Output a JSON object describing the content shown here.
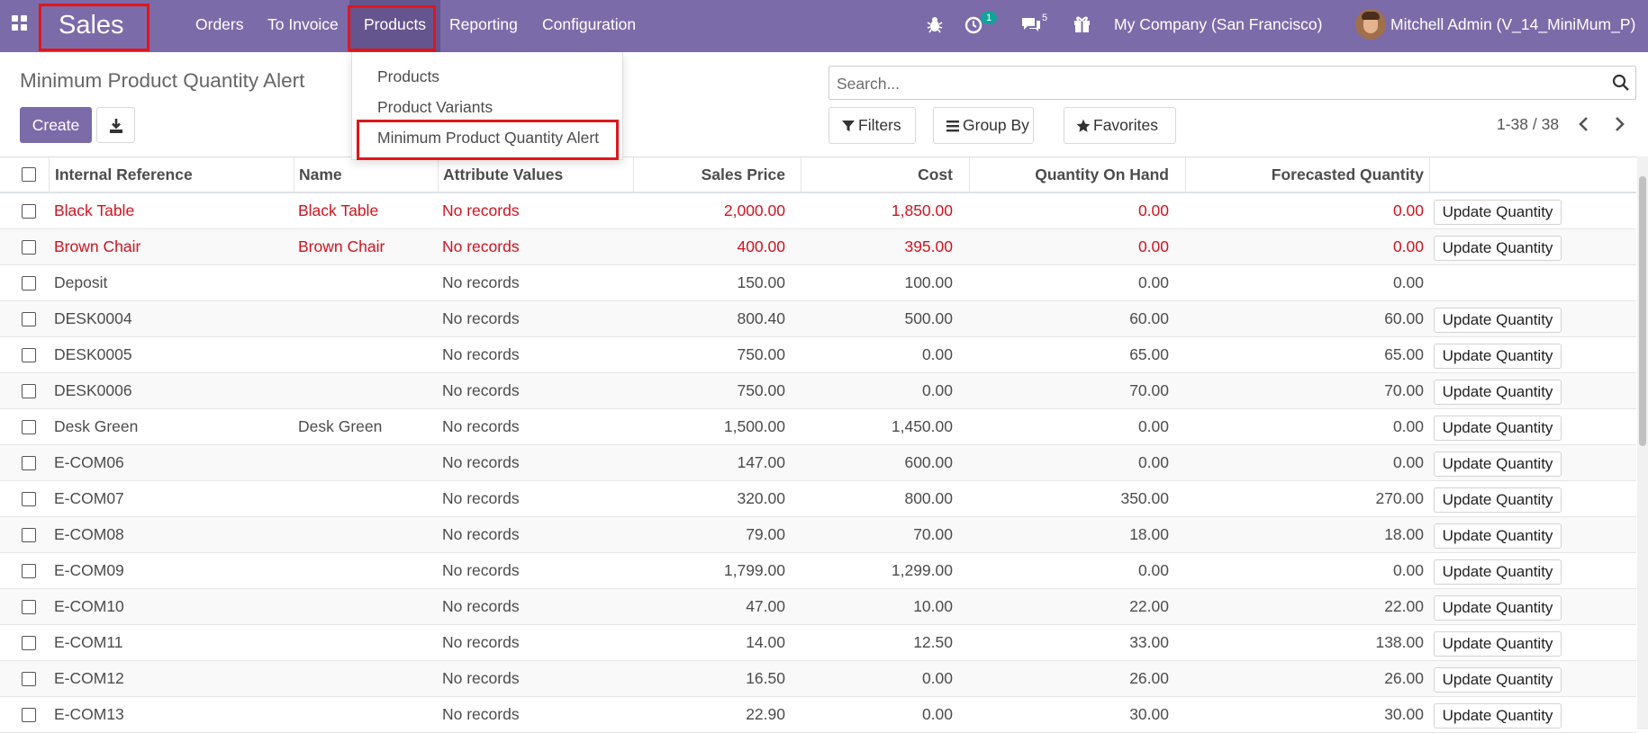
{
  "navbar": {
    "app_name": "Sales",
    "menu": [
      "Orders",
      "To Invoice",
      "Products",
      "Reporting",
      "Configuration"
    ],
    "activity_count": "1",
    "message_count": "5",
    "company": "My Company (San Francisco)",
    "user": "Mitchell Admin (V_14_MiniMum_P)",
    "icons": [
      "apps-icon",
      "bug-icon",
      "clock-icon",
      "chat-icon",
      "gift-icon"
    ]
  },
  "dropdown": {
    "items": [
      "Products",
      "Product Variants",
      "Minimum Product Quantity Alert"
    ]
  },
  "control_panel": {
    "title": "Minimum Product Quantity Alert",
    "create_label": "Create",
    "search_placeholder": "Search...",
    "filters_label": "Filters",
    "group_by_label": "Group By",
    "favorites_label": "Favorites",
    "pager": "1-38 / 38"
  },
  "table": {
    "headers": [
      "Internal Reference",
      "Name",
      "Attribute Values",
      "Sales Price",
      "Cost",
      "Quantity On Hand",
      "Forecasted Quantity"
    ],
    "update_label": "Update Quantity",
    "rows": [
      {
        "ref": "Black Table",
        "name": "Black Table",
        "attr": "No records",
        "price": "2,000.00",
        "cost": "1,850.00",
        "onhand": "0.00",
        "forecast": "0.00",
        "alert": true,
        "update": true
      },
      {
        "ref": "Brown Chair",
        "name": "Brown Chair",
        "attr": "No records",
        "price": "400.00",
        "cost": "395.00",
        "onhand": "0.00",
        "forecast": "0.00",
        "alert": true,
        "update": true
      },
      {
        "ref": "Deposit",
        "name": "",
        "attr": "No records",
        "price": "150.00",
        "cost": "100.00",
        "onhand": "0.00",
        "forecast": "0.00",
        "alert": false,
        "update": false
      },
      {
        "ref": "DESK0004",
        "name": "",
        "attr": "No records",
        "price": "800.40",
        "cost": "500.00",
        "onhand": "60.00",
        "forecast": "60.00",
        "alert": false,
        "update": true
      },
      {
        "ref": "DESK0005",
        "name": "",
        "attr": "No records",
        "price": "750.00",
        "cost": "0.00",
        "onhand": "65.00",
        "forecast": "65.00",
        "alert": false,
        "update": true
      },
      {
        "ref": "DESK0006",
        "name": "",
        "attr": "No records",
        "price": "750.00",
        "cost": "0.00",
        "onhand": "70.00",
        "forecast": "70.00",
        "alert": false,
        "update": true
      },
      {
        "ref": "Desk Green",
        "name": "Desk Green",
        "attr": "No records",
        "price": "1,500.00",
        "cost": "1,450.00",
        "onhand": "0.00",
        "forecast": "0.00",
        "alert": false,
        "update": true
      },
      {
        "ref": "E-COM06",
        "name": "",
        "attr": "No records",
        "price": "147.00",
        "cost": "600.00",
        "onhand": "0.00",
        "forecast": "0.00",
        "alert": false,
        "update": true
      },
      {
        "ref": "E-COM07",
        "name": "",
        "attr": "No records",
        "price": "320.00",
        "cost": "800.00",
        "onhand": "350.00",
        "forecast": "270.00",
        "alert": false,
        "update": true
      },
      {
        "ref": "E-COM08",
        "name": "",
        "attr": "No records",
        "price": "79.00",
        "cost": "70.00",
        "onhand": "18.00",
        "forecast": "18.00",
        "alert": false,
        "update": true
      },
      {
        "ref": "E-COM09",
        "name": "",
        "attr": "No records",
        "price": "1,799.00",
        "cost": "1,299.00",
        "onhand": "0.00",
        "forecast": "0.00",
        "alert": false,
        "update": true
      },
      {
        "ref": "E-COM10",
        "name": "",
        "attr": "No records",
        "price": "47.00",
        "cost": "10.00",
        "onhand": "22.00",
        "forecast": "22.00",
        "alert": false,
        "update": true
      },
      {
        "ref": "E-COM11",
        "name": "",
        "attr": "No records",
        "price": "14.00",
        "cost": "12.50",
        "onhand": "33.00",
        "forecast": "138.00",
        "alert": false,
        "update": true
      },
      {
        "ref": "E-COM12",
        "name": "",
        "attr": "No records",
        "price": "16.50",
        "cost": "0.00",
        "onhand": "26.00",
        "forecast": "26.00",
        "alert": false,
        "update": true
      },
      {
        "ref": "E-COM13",
        "name": "",
        "attr": "No records",
        "price": "22.90",
        "cost": "0.00",
        "onhand": "30.00",
        "forecast": "30.00",
        "alert": false,
        "update": true
      }
    ]
  }
}
